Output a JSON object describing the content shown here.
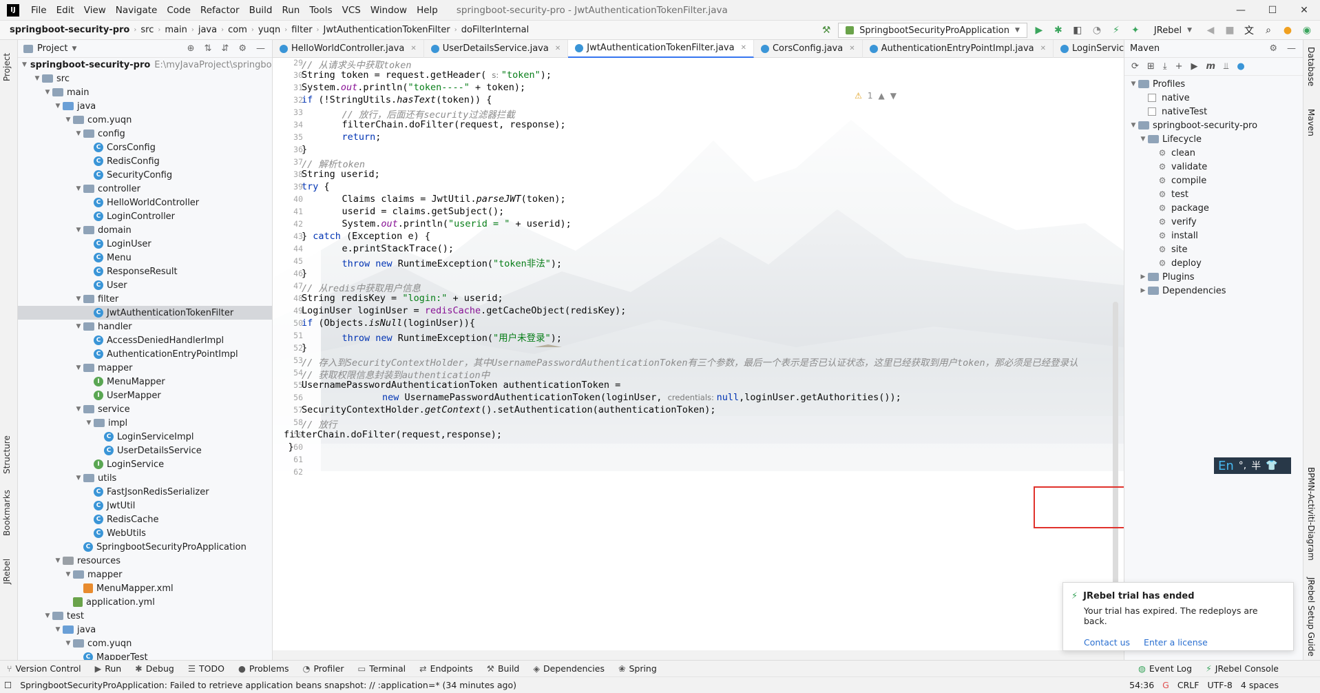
{
  "window": {
    "title": "springboot-security-pro - JwtAuthenticationTokenFilter.java",
    "menu": [
      "File",
      "Edit",
      "View",
      "Navigate",
      "Code",
      "Refactor",
      "Build",
      "Run",
      "Tools",
      "VCS",
      "Window",
      "Help"
    ]
  },
  "breadcrumbs": [
    "springboot-security-pro",
    "src",
    "main",
    "java",
    "com",
    "yuqn",
    "filter",
    "JwtAuthenticationTokenFilter",
    "doFilterInternal"
  ],
  "toolbar": {
    "run_config": "SpringbootSecurityProApplication",
    "jrebel": "JRebel"
  },
  "project_panel": {
    "title": "Project",
    "root_name": "springboot-security-pro",
    "root_path": "E:\\myJavaProject\\springboot-",
    "tree": [
      {
        "label": "src",
        "depth": 1,
        "kind": "folder",
        "open": true
      },
      {
        "label": "main",
        "depth": 2,
        "kind": "folder",
        "open": true
      },
      {
        "label": "java",
        "depth": 3,
        "kind": "folderblue",
        "open": true
      },
      {
        "label": "com.yuqn",
        "depth": 4,
        "kind": "folder",
        "open": true
      },
      {
        "label": "config",
        "depth": 5,
        "kind": "folder",
        "open": true
      },
      {
        "label": "CorsConfig",
        "depth": 6,
        "kind": "class"
      },
      {
        "label": "RedisConfig",
        "depth": 6,
        "kind": "class"
      },
      {
        "label": "SecurityConfig",
        "depth": 6,
        "kind": "class"
      },
      {
        "label": "controller",
        "depth": 5,
        "kind": "folder",
        "open": true
      },
      {
        "label": "HelloWorldController",
        "depth": 6,
        "kind": "class"
      },
      {
        "label": "LoginController",
        "depth": 6,
        "kind": "class"
      },
      {
        "label": "domain",
        "depth": 5,
        "kind": "folder",
        "open": true
      },
      {
        "label": "LoginUser",
        "depth": 6,
        "kind": "class"
      },
      {
        "label": "Menu",
        "depth": 6,
        "kind": "class"
      },
      {
        "label": "ResponseResult",
        "depth": 6,
        "kind": "class"
      },
      {
        "label": "User",
        "depth": 6,
        "kind": "class"
      },
      {
        "label": "filter",
        "depth": 5,
        "kind": "folder",
        "open": true
      },
      {
        "label": "JwtAuthenticationTokenFilter",
        "depth": 6,
        "kind": "class",
        "selected": true
      },
      {
        "label": "handler",
        "depth": 5,
        "kind": "folder",
        "open": true
      },
      {
        "label": "AccessDeniedHandlerImpl",
        "depth": 6,
        "kind": "class"
      },
      {
        "label": "AuthenticationEntryPointImpl",
        "depth": 6,
        "kind": "class"
      },
      {
        "label": "mapper",
        "depth": 5,
        "kind": "folder",
        "open": true
      },
      {
        "label": "MenuMapper",
        "depth": 6,
        "kind": "interface"
      },
      {
        "label": "UserMapper",
        "depth": 6,
        "kind": "interface"
      },
      {
        "label": "service",
        "depth": 5,
        "kind": "folder",
        "open": true
      },
      {
        "label": "impl",
        "depth": 6,
        "kind": "folder",
        "open": true
      },
      {
        "label": "LoginServiceImpl",
        "depth": 7,
        "kind": "class"
      },
      {
        "label": "UserDetailsService",
        "depth": 7,
        "kind": "class"
      },
      {
        "label": "LoginService",
        "depth": 6,
        "kind": "interface"
      },
      {
        "label": "utils",
        "depth": 5,
        "kind": "folder",
        "open": true
      },
      {
        "label": "FastJsonRedisSerializer",
        "depth": 6,
        "kind": "class"
      },
      {
        "label": "JwtUtil",
        "depth": 6,
        "kind": "class"
      },
      {
        "label": "RedisCache",
        "depth": 6,
        "kind": "class"
      },
      {
        "label": "WebUtils",
        "depth": 6,
        "kind": "class"
      },
      {
        "label": "SpringbootSecurityProApplication",
        "depth": 5,
        "kind": "class"
      },
      {
        "label": "resources",
        "depth": 3,
        "kind": "folderres",
        "open": true
      },
      {
        "label": "mapper",
        "depth": 4,
        "kind": "folder",
        "open": true
      },
      {
        "label": "MenuMapper.xml",
        "depth": 5,
        "kind": "xml"
      },
      {
        "label": "application.yml",
        "depth": 4,
        "kind": "yml"
      },
      {
        "label": "test",
        "depth": 2,
        "kind": "folder",
        "open": true
      },
      {
        "label": "java",
        "depth": 3,
        "kind": "folderblue",
        "open": true
      },
      {
        "label": "com.yuqn",
        "depth": 4,
        "kind": "folder",
        "open": true
      },
      {
        "label": "MapperTest",
        "depth": 5,
        "kind": "class"
      }
    ]
  },
  "tabs": [
    "HelloWorldController.java",
    "UserDetailsService.java",
    "JwtAuthenticationTokenFilter.java",
    "CorsConfig.java",
    "AuthenticationEntryPointImpl.java",
    "LoginServiceImpl.java"
  ],
  "active_tab": "JwtAuthenticationTokenFilter.java",
  "editor": {
    "warning_count": "1",
    "lines": [
      {
        "n": "29",
        "html": "<span class='cm'>// 从请求头中获取token</span>"
      },
      {
        "n": "30",
        "html": "String token = request.getHeader( <span class='inl'>s: </span><span class='str'>\"token\"</span>);"
      },
      {
        "n": "31",
        "html": "System.<span class='st'>out</span>.println(<span class='str'>\"token----\"</span> + token);"
      },
      {
        "n": "32",
        "html": "<span class='kw'>if</span> (!StringUtils.<span class='it'>hasText</span>(token)) {"
      },
      {
        "n": "33",
        "html": "    <span class='cm'>// 放行，后面还有security过滤器拦截</span>"
      },
      {
        "n": "34",
        "html": "    filterChain.doFilter(request, response);"
      },
      {
        "n": "35",
        "html": "    <span class='kw'>return</span>;"
      },
      {
        "n": "36",
        "html": "}"
      },
      {
        "n": "37",
        "html": "<span class='cm'>// 解析token</span>"
      },
      {
        "n": "38",
        "html": "String userid;"
      },
      {
        "n": "39",
        "html": "<span class='kw'>try</span> {"
      },
      {
        "n": "40",
        "html": "    Claims claims = JwtUtil.<span class='it'>parseJWT</span>(token);"
      },
      {
        "n": "41",
        "html": "    userid = claims.getSubject();"
      },
      {
        "n": "42",
        "html": "    System.<span class='st'>out</span>.println(<span class='str'>\"userid = \"</span> + userid);"
      },
      {
        "n": "43",
        "html": "} <span class='kw'>catch</span> (Exception e) {"
      },
      {
        "n": "44",
        "html": "    e.printStackTrace();"
      },
      {
        "n": "45",
        "html": "    <span class='kw'>throw new</span> RuntimeException(<span class='str'>\"token非法\"</span>);"
      },
      {
        "n": "46",
        "html": "}"
      },
      {
        "n": "47",
        "html": "<span class='cm'>// 从redis中获取用户信息</span>"
      },
      {
        "n": "48",
        "html": "String redisKey = <span class='str'>\"login:\"</span> + userid;"
      },
      {
        "n": "49",
        "html": "LoginUser loginUser = <span class='fld'>redisCache</span>.getCacheObject(redisKey);"
      },
      {
        "n": "50",
        "html": "<span class='kw'>if</span> (Objects.<span class='it'>isNull</span>(loginUser)){"
      },
      {
        "n": "51",
        "html": "    <span class='kw'>throw new</span> RuntimeException(<span class='str'>\"用户未登录\"</span>);"
      },
      {
        "n": "52",
        "html": "}"
      },
      {
        "n": "53",
        "html": "<span class='cm'>// 存入到SecurityContextHolder，其中UsernamePasswordAuthenticationToken有三个参数，最后一个表示是否已认证状态，这里已经获取到用户token，那必须是已经登录认</span>"
      },
      {
        "n": "54",
        "html": "<span class='cm'>// 获取权限信息封装到authentication中</span>"
      },
      {
        "n": "55",
        "html": "UsernamePasswordAuthenticationToken authenticationToken ="
      },
      {
        "n": "56",
        "html": "        <span class='kw'>new</span> UsernamePasswordAuthenticationToken(loginUser, <span class='inl'>credentials: </span><span class='kw'>null</span>,loginUser.getAuthorities());"
      },
      {
        "n": "57",
        "html": "SecurityContextHolder.<span class='it'>getContext</span>().setAuthentication(authenticationToken);"
      },
      {
        "n": "58",
        "html": "<span class='cm'>// 放行</span>"
      },
      {
        "n": "59",
        "html": "filterChain.doFilter(request,response);"
      },
      {
        "n": "60",
        "html": "    }"
      },
      {
        "n": "61",
        "html": "}"
      },
      {
        "n": "62",
        "html": ""
      }
    ]
  },
  "maven": {
    "title": "Maven",
    "profiles_label": "Profiles",
    "profiles": [
      "native",
      "nativeTest"
    ],
    "project": "springboot-security-pro",
    "lifecycle_label": "Lifecycle",
    "lifecycle": [
      "clean",
      "validate",
      "compile",
      "test",
      "package",
      "verify",
      "install",
      "site",
      "deploy"
    ],
    "plugins": "Plugins",
    "dependencies": "Dependencies"
  },
  "ime": {
    "lang": "En",
    "punct": "°,",
    "width": "半"
  },
  "notification": {
    "title": "JRebel trial has ended",
    "body": "Your trial has expired. The redeploys are back.",
    "link1": "Contact us",
    "link2": "Enter a license"
  },
  "left_strip": [
    "Project",
    "Structure",
    "Bookmarks",
    "JRebel"
  ],
  "right_strip": [
    "Database",
    "Maven",
    "BPMN-Activiti-Diagram",
    "JRebel Setup Guide"
  ],
  "tool_windows": [
    "Version Control",
    "Run",
    "Debug",
    "TODO",
    "Problems",
    "Profiler",
    "Terminal",
    "Endpoints",
    "Build",
    "Dependencies",
    "Spring"
  ],
  "tool_windows_right": [
    "Event Log",
    "JRebel Console"
  ],
  "status": {
    "message": "SpringbootSecurityProApplication: Failed to retrieve application beans snapshot: // :application=* (34 minutes ago)",
    "position": "54:36",
    "line_sep": "CRLF",
    "encoding": "UTF-8",
    "indent": "4 spaces"
  },
  "colors": {
    "accent": "#3574f0",
    "highlight_box": "#e0312b",
    "class_icon": "#3a95d7"
  }
}
